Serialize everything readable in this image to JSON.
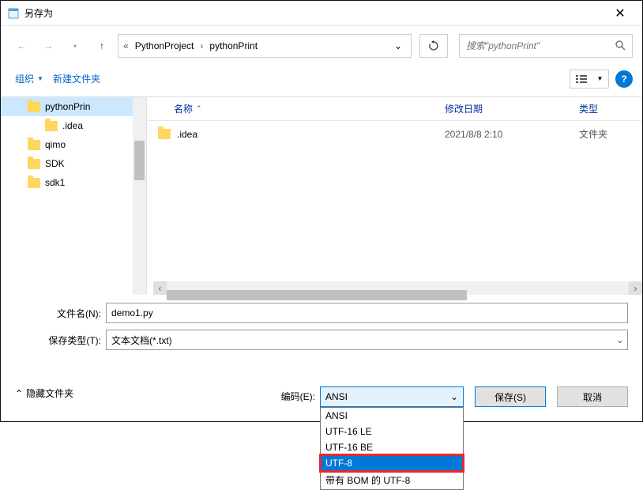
{
  "title": "另存为",
  "path": {
    "prefix": "«",
    "seg1": "PythonProject",
    "seg2": "pythonPrint"
  },
  "search": {
    "placeholder": "搜索\"pythonPrint\""
  },
  "toolbar": {
    "organize": "组织",
    "newfolder": "新建文件夹"
  },
  "tree": [
    {
      "label": "pythonPrin",
      "level": 1,
      "selected": true
    },
    {
      "label": ".idea",
      "level": 2,
      "selected": false
    },
    {
      "label": "qimo",
      "level": 1,
      "selected": false
    },
    {
      "label": "SDK",
      "level": 1,
      "selected": false
    },
    {
      "label": "sdk1",
      "level": 1,
      "selected": false
    }
  ],
  "columns": {
    "name": "名称",
    "date": "修改日期",
    "type": "类型"
  },
  "rows": [
    {
      "name": ".idea",
      "date": "2021/8/8 2:10",
      "type": "文件夹"
    }
  ],
  "filename": {
    "label": "文件名(N):",
    "value": "demo1.py"
  },
  "filetype": {
    "label": "保存类型(T):",
    "value": "文本文档(*.txt)"
  },
  "hidefolders": "隐藏文件夹",
  "encoding": {
    "label": "编码(E):",
    "value": "ANSI",
    "options": [
      "ANSI",
      "UTF-16 LE",
      "UTF-16 BE",
      "UTF-8",
      "带有 BOM 的 UTF-8"
    ],
    "highlighted": "UTF-8"
  },
  "buttons": {
    "save": "保存(S)",
    "cancel": "取消"
  }
}
